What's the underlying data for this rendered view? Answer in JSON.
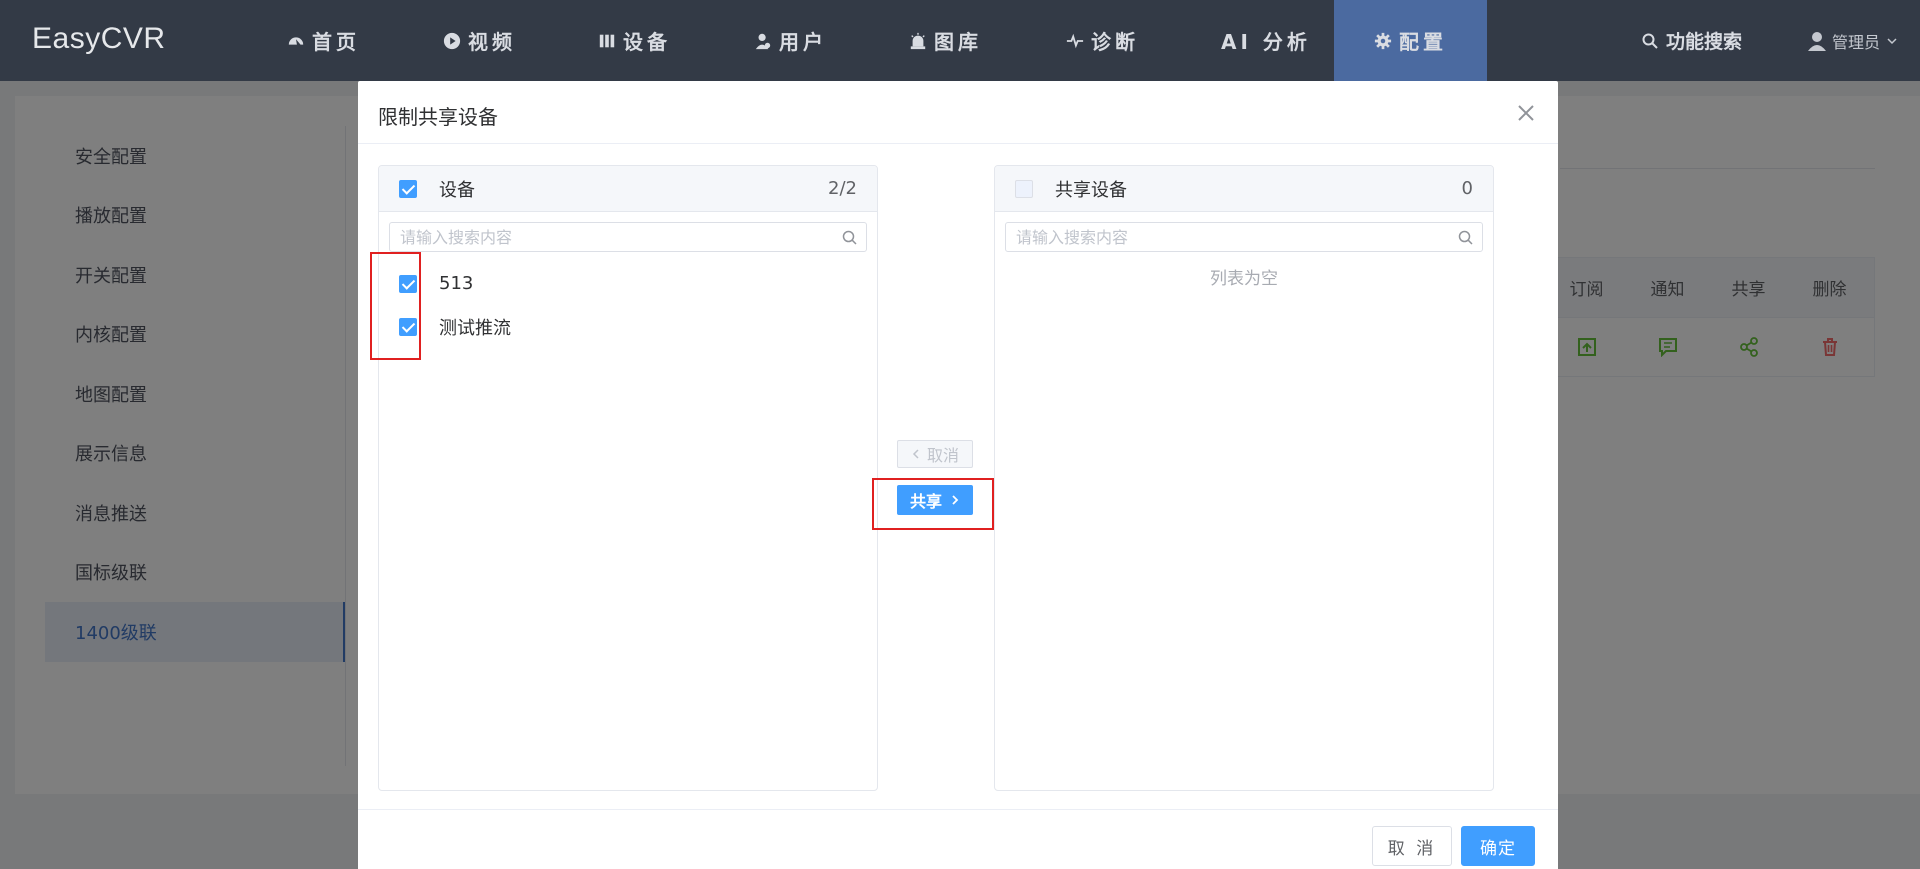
{
  "brand": "EasyCVR",
  "nav": {
    "items": [
      {
        "label": "首页",
        "icon": "dashboard-icon"
      },
      {
        "label": "视频",
        "icon": "play-icon"
      },
      {
        "label": "设备",
        "icon": "device-icon"
      },
      {
        "label": "用户",
        "icon": "user-icon"
      },
      {
        "label": "图库",
        "icon": "alarm-icon"
      },
      {
        "label": "诊断",
        "icon": "pulse-icon"
      },
      {
        "label": "AI 分析",
        "icon": ""
      },
      {
        "label": "配置",
        "icon": "gear-icon"
      }
    ],
    "active": "配置",
    "search_label": "功能搜索",
    "user_label": "管理员"
  },
  "sidebar": {
    "items": [
      {
        "label": "安全配置"
      },
      {
        "label": "播放配置"
      },
      {
        "label": "开关配置"
      },
      {
        "label": "内核配置"
      },
      {
        "label": "地图配置"
      },
      {
        "label": "展示信息"
      },
      {
        "label": "消息推送"
      },
      {
        "label": "国标级联"
      },
      {
        "label": "1400级联"
      }
    ],
    "active": "1400级联"
  },
  "bg_table": {
    "headers": [
      "订阅",
      "通知",
      "共享",
      "删除"
    ],
    "row_icons": [
      "subscribe-icon",
      "notify-icon",
      "share-icon",
      "delete-icon"
    ],
    "colors": {
      "green": "#67c23a",
      "red": "#f56c6c"
    }
  },
  "dialog": {
    "title": "限制共享设备",
    "left_panel": {
      "title": "设备",
      "count": "2/2",
      "search_placeholder": "请输入搜索内容",
      "items": [
        {
          "label": "513",
          "checked": true
        },
        {
          "label": "测试推流",
          "checked": true
        }
      ]
    },
    "right_panel": {
      "title": "共享设备",
      "count": "0",
      "search_placeholder": "请输入搜索内容",
      "empty_text": "列表为空"
    },
    "transfer": {
      "cancel_label": "取消",
      "share_label": "共享"
    },
    "footer": {
      "cancel_label": "取 消",
      "confirm_label": "确定"
    }
  },
  "colors": {
    "nav_bg": "#333a46",
    "nav_active": "#4b6aa0",
    "primary": "#409eff",
    "highlight": "#e02020"
  }
}
